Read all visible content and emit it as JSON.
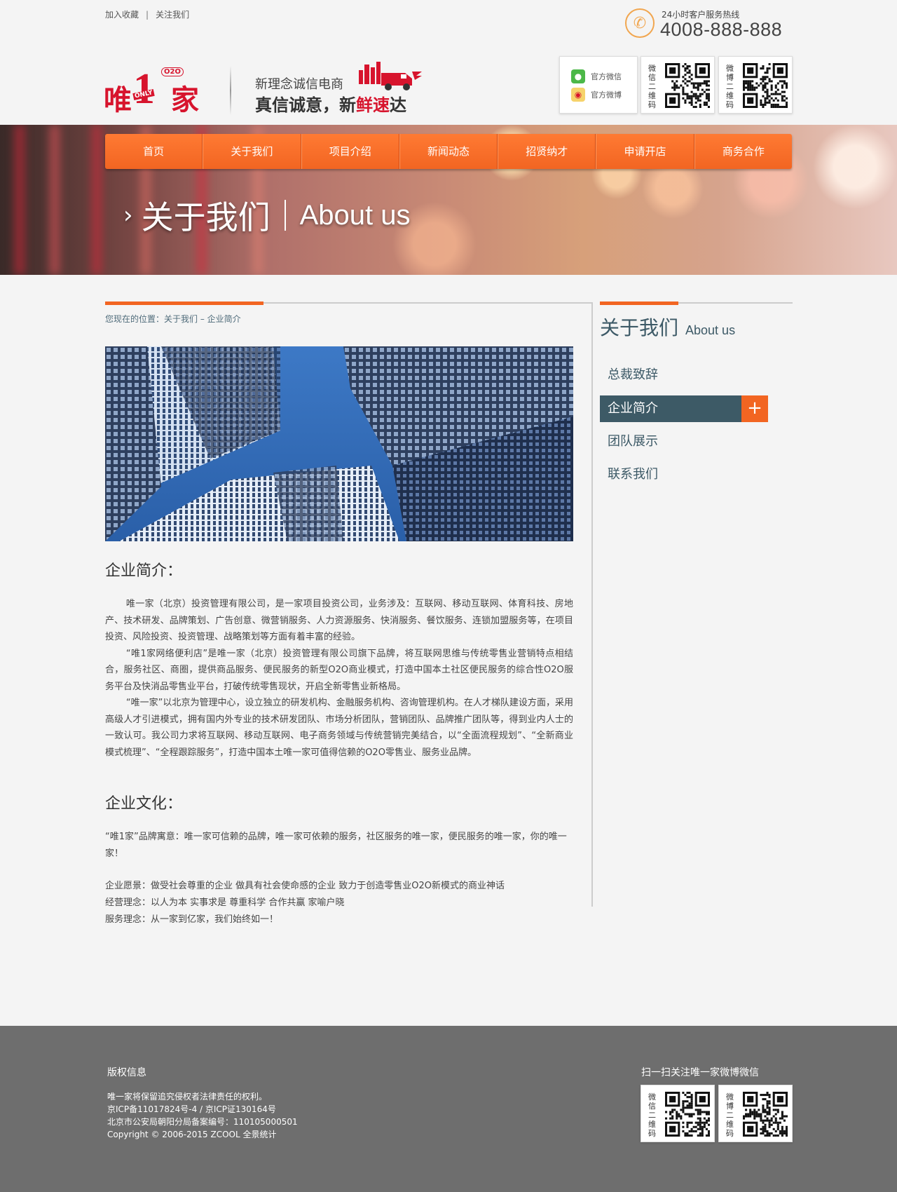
{
  "topbar": {
    "bookmark": "加入收藏",
    "separator": "|",
    "follow": "关注我们"
  },
  "hotline": {
    "label": "24小时客户服务热线",
    "number": "4008-888-888"
  },
  "logo": {
    "wei": "唯",
    "one": "1",
    "only": "ONLY",
    "o2o": "O2O",
    "jia": "家"
  },
  "slogan": {
    "line1": "新理念诚信电商",
    "line2_a": "真信诚意，新",
    "line2_hl": "鲜速",
    "line2_b": "达"
  },
  "social": {
    "wechat_label": "官方微信",
    "weibo_label": "官方微博"
  },
  "qr": {
    "wechat_label": "微信二维码",
    "weibo_label": "微博二维码"
  },
  "nav": [
    {
      "label": "首页"
    },
    {
      "label": "关于我们"
    },
    {
      "label": "项目介绍"
    },
    {
      "label": "新闻动态"
    },
    {
      "label": "招贤纳才"
    },
    {
      "label": "申请开店"
    },
    {
      "label": "商务合作"
    }
  ],
  "banner": {
    "title_cn": "关于我们",
    "title_en": "About us"
  },
  "breadcrumb": "您现在的位置：关于我们 – 企业简介",
  "intro": {
    "heading": "企业简介：",
    "paragraphs": [
      "唯一家（北京）投资管理有限公司，是一家项目投资公司，业务涉及：互联网、移动互联网、体育科技、房地产、技术研发、品牌策划、广告创意、微营销服务、人力资源服务、快消服务、餐饮服务、连锁加盟服务等，在项目投资、风险投资、投资管理、战略策划等方面有着丰富的经验。",
      "“唯1家网络便利店”是唯一家（北京）投资管理有限公司旗下品牌，将互联网思维与传统零售业营销特点相结合，服务社区、商圈，提供商品服务、便民服务的新型O2O商业模式，打造中国本土社区便民服务的综合性O2O服务平台及快消品零售业平台，打破传统零售现状，开启全新零售业新格局。",
      "“唯一家”以北京为管理中心，设立独立的研发机构、金融服务机构、咨询管理机构。在人才梯队建设方面，采用高级人才引进模式，拥有国内外专业的技术研发团队、市场分析团队，营销团队、品牌推广团队等，得到业内人士的一致认可。我公司力求将互联网、移动互联网、电子商务领域与传统营销完美结合，以“全面流程规划”、“全新商业模式梳理”、“全程跟踪服务”，打造中国本土唯一家可值得信赖的O2O零售业、服务业品牌。"
    ]
  },
  "culture": {
    "heading": "企业文化：",
    "brand": "“唯1家”品牌寓意：唯一家可信赖的品牌，唯一家可依赖的服务，社区服务的唯一家，便民服务的唯一家，你的唯一家！",
    "vision": "企业愿景：做受社会尊重的企业  做具有社会使命感的企业  致力于创造零售业O2O新模式的商业神话",
    "philosophy": "经营理念：以人为本  实事求是  尊重科学  合作共赢   家喻户晓",
    "service": "服务理念：从一家到亿家，我们始终如一！"
  },
  "sidebar": {
    "title_cn": "关于我们",
    "title_en": "About us",
    "items": [
      {
        "label": "总裁致辞"
      },
      {
        "label": "企业简介"
      },
      {
        "label": "团队展示"
      },
      {
        "label": "联系我们"
      }
    ],
    "active_plus": "+"
  },
  "footer": {
    "title": "版权信息",
    "line1": "唯一家将保留追究侵权者法律责任的权利。",
    "line2": "京ICP备11017824号-4 / 京ICP证130164号",
    "line3": "北京市公安局朝阳分局备案编号：110105000501",
    "line4": "Copyright © 2006-2015 ZCOOL 全景统计",
    "qr_title": "扫一扫关注唯一家微博微信"
  },
  "colors": {
    "brand": "#d7142d",
    "accent": "#f26522",
    "sidebar_active": "#3d5a66",
    "footer": "#6e6e6e"
  }
}
